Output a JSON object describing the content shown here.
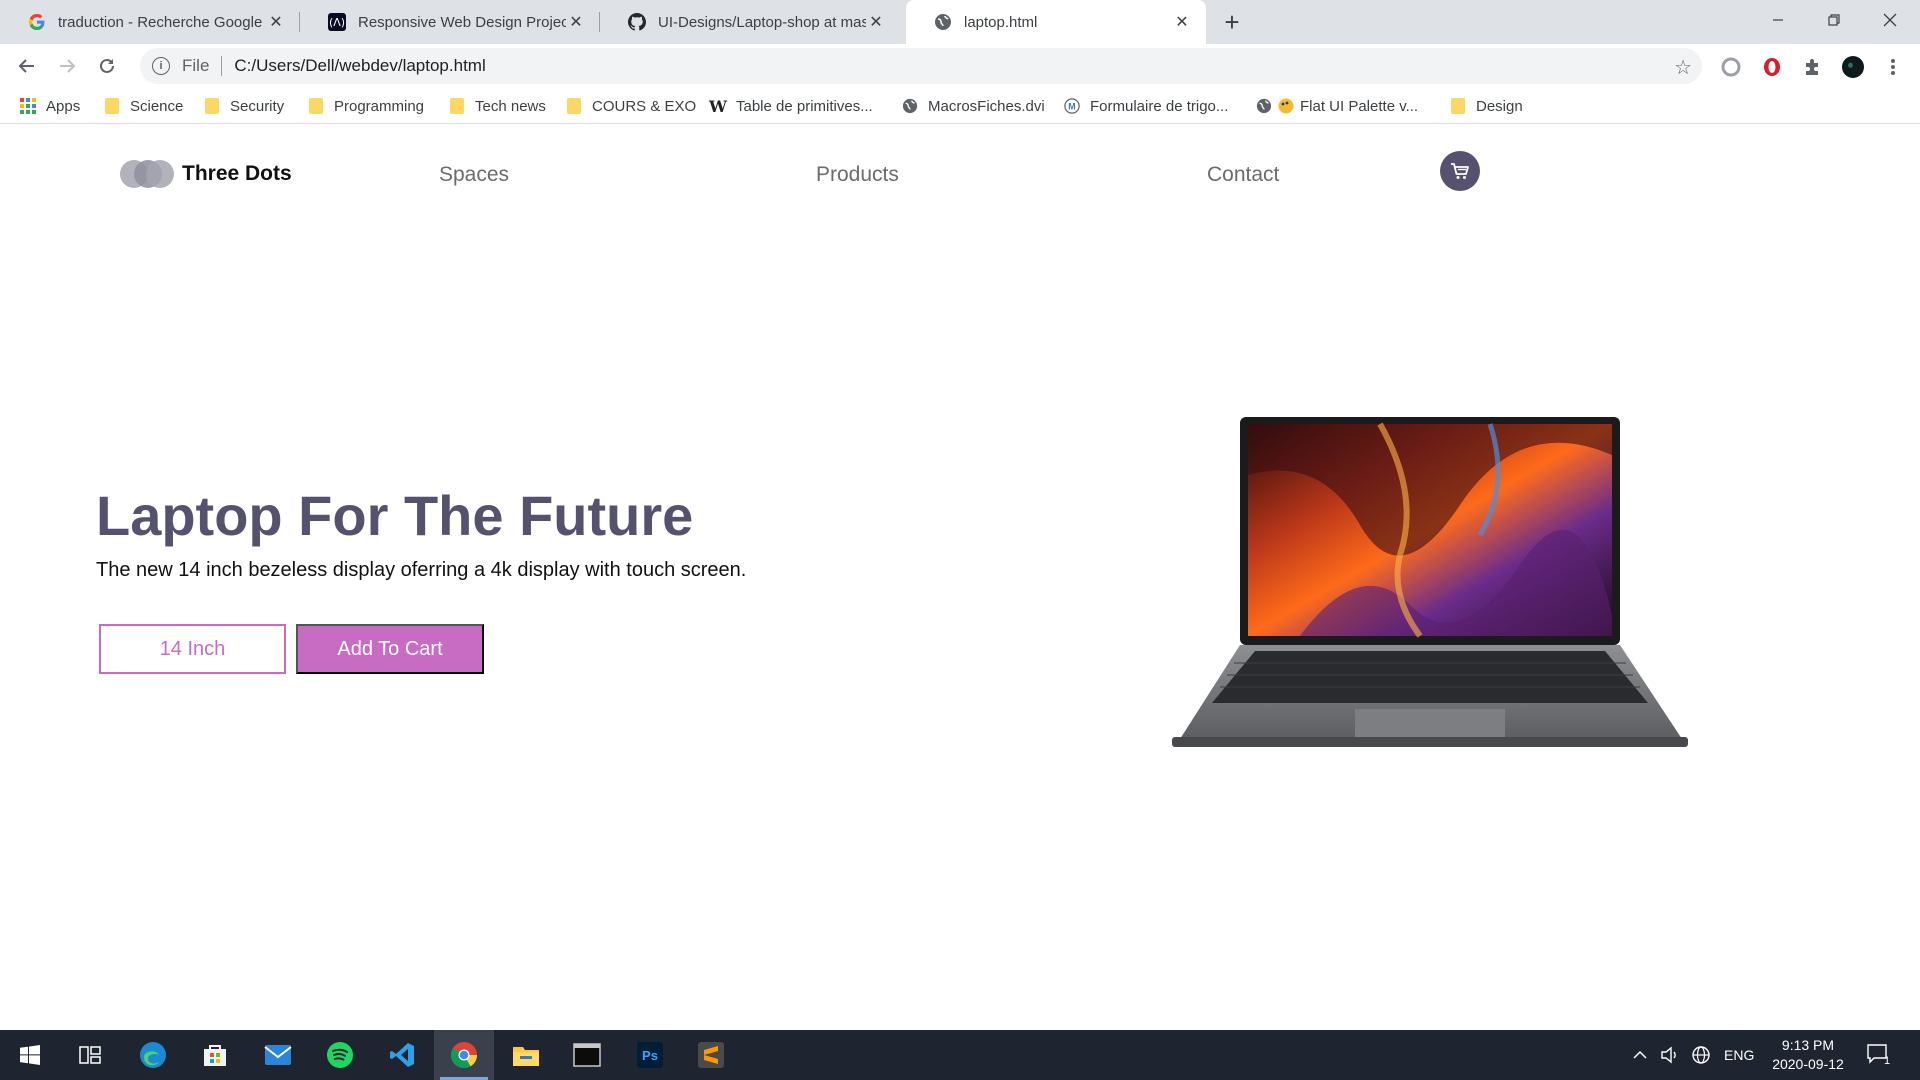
{
  "browser": {
    "tabs": [
      {
        "title": "traduction - Recherche Google",
        "icon": "google-icon",
        "active": false
      },
      {
        "title": "Responsive Web Design Projects",
        "icon": "freecodecamp-icon",
        "active": false
      },
      {
        "title": "UI-Designs/Laptop-shop at mast",
        "icon": "github-icon",
        "active": false
      },
      {
        "title": "laptop.html",
        "icon": "globe-icon",
        "active": true
      }
    ],
    "address": {
      "scheme": "File",
      "url": "C:/Users/Dell/webdev/laptop.html"
    },
    "bookmarks": [
      {
        "label": "Apps",
        "icon": "apps-grid-icon"
      },
      {
        "label": "Science",
        "icon": "folder-icon"
      },
      {
        "label": "Security",
        "icon": "folder-icon"
      },
      {
        "label": "Programming",
        "icon": "folder-icon"
      },
      {
        "label": "Tech news",
        "icon": "folder-icon"
      },
      {
        "label": "COURS & EXO",
        "icon": "folder-icon"
      },
      {
        "label": "Table de primitives...",
        "icon": "wikipedia-icon"
      },
      {
        "label": "MacrosFiches.dvi",
        "icon": "globe-icon"
      },
      {
        "label": "Formulaire de trigo...",
        "icon": "m-site-icon"
      },
      {
        "label": "Flat UI Palette v...",
        "icon": "palette-icon"
      },
      {
        "label": "Design",
        "icon": "folder-icon"
      }
    ]
  },
  "site": {
    "logo": "Three Dots",
    "nav": [
      "Spaces",
      "Products",
      "Contact"
    ],
    "hero": {
      "title": "Laptop For The Future",
      "subtitle": "The new 14 inch bezeless display oferring a 4k display with touch screen.",
      "size_button": "14 Inch",
      "cart_button": "Add To Cart"
    },
    "colors": {
      "accent": "#c86bc3",
      "heading": "#55526f",
      "cart_circle": "#55516e"
    }
  },
  "taskbar": {
    "apps": [
      "windows-start-icon",
      "task-view-icon",
      "edge-icon",
      "store-icon",
      "mail-icon",
      "spotify-icon",
      "vscode-icon",
      "chrome-icon",
      "file-explorer-icon",
      "terminal-icon",
      "photoshop-icon",
      "sublime-icon"
    ],
    "language": "ENG",
    "time": "9:13 PM",
    "date": "2020-09-12",
    "notifications": "1"
  }
}
